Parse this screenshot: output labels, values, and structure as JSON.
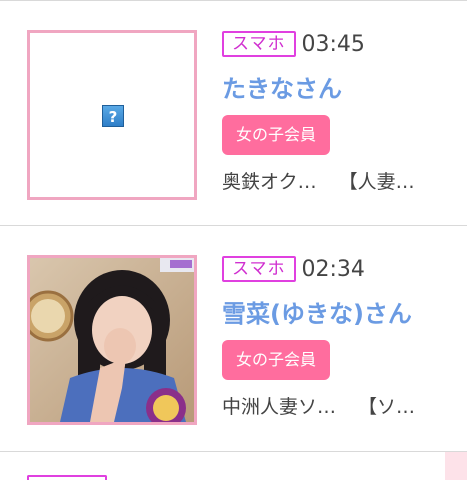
{
  "entries": [
    {
      "device": "スマホ",
      "time": "03:45",
      "name": "たきなさん",
      "member_label": "女の子会員",
      "shop": "奥鉄オク…",
      "category": "【人妻…",
      "photo": "missing-image-icon"
    },
    {
      "device": "スマホ",
      "time": "02:34",
      "name": "雪菜(ゆきな)さん",
      "member_label": "女の子会員",
      "shop": "中洲人妻ソ…",
      "category": "【ソ…",
      "photo": "profile-photo"
    }
  ],
  "colors": {
    "device_badge": "#d02fd0",
    "name": "#6b9be3",
    "member_badge": "#ff6d9e",
    "thumb_border": "#f0a6c1"
  }
}
